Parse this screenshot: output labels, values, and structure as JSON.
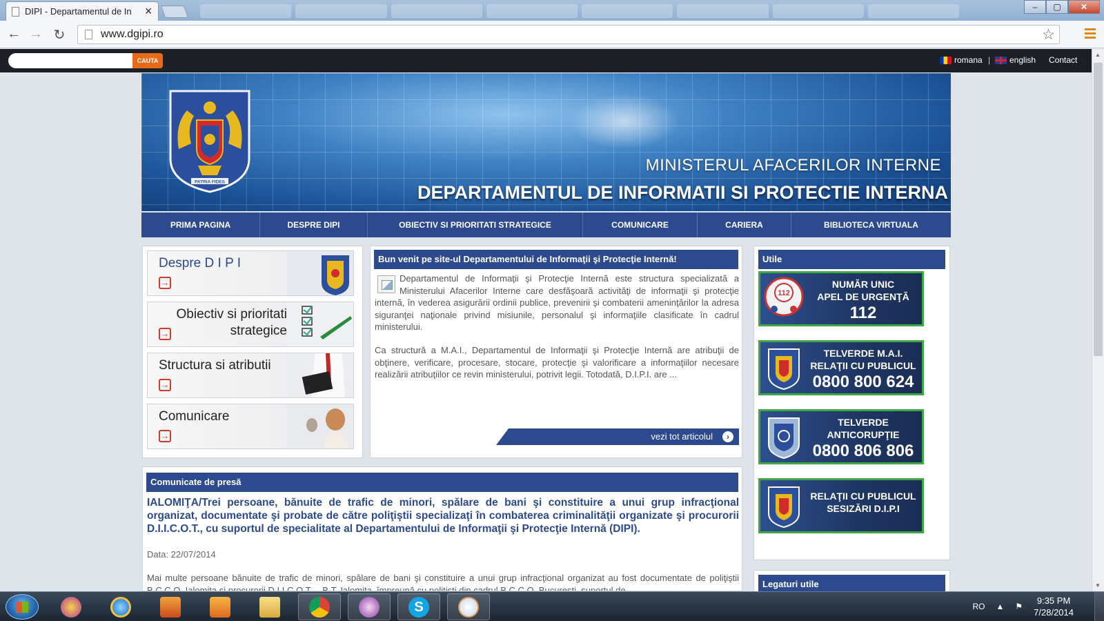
{
  "browser": {
    "tab_title": "DIPI - Departamentul de In",
    "url": "www.dgipi.ro"
  },
  "topbar": {
    "search_placeholder": "",
    "search_button": "CAUTA",
    "lang_ro": "romana",
    "separator": "|",
    "lang_en": "english",
    "contact": "Contact"
  },
  "banner": {
    "line1": "MINISTERUL AFACERILOR INTERNE",
    "line2": "DEPARTAMENTUL DE INFORMATII SI PROTECTIE INTERNA",
    "crest_motto": "PATRIA FIDES"
  },
  "nav": {
    "items": [
      {
        "label": "PRIMA PAGINA"
      },
      {
        "label": "DESPRE DIPI"
      },
      {
        "label": "OBIECTIV SI PRIORITATI STRATEGICE"
      },
      {
        "label": "COMUNICARE"
      },
      {
        "label": "CARIERA"
      },
      {
        "label": "BIBLIOTECA VIRTUALA"
      }
    ]
  },
  "left_tiles": [
    {
      "label": "Despre D I P I"
    },
    {
      "label": "Obiectiv si prioritati strategice"
    },
    {
      "label": "Structura si atributii"
    },
    {
      "label": "Comunicare"
    }
  ],
  "welcome": {
    "heading": "Bun venit pe site-ul Departamentului de Informaţii şi Protecţie Internă!",
    "paragraph1": "Departamentul de Informaţii şi Protecţie Internă este structura specializată a Ministerului Afacerilor Interne care desfăşoară activităţi de informaţii şi protecţie internă, în vederea asigurării ordinii publice, prevenirii şi combaterii ameninţărilor la adresa siguranţei naţionale privind misiunile, personalul şi informaţiile clasificate în cadrul ministerului.",
    "paragraph2": "Ca structură a M.A.I., Departamentul de Informaţii şi Protecţie Internă are atribuţii de obţinere, verificare, procesare, stocare, protecţie şi valorificare a informaţiilor necesare realizării atribuţiilor ce revin ministerului, potrivit legii. Totodată, D.I.P.I. are ...",
    "read_more": "vezi tot articolul"
  },
  "press": {
    "heading": "Comunicate de presă",
    "headline": "IALOMIŢA/Trei persoane, bănuite de trafic de minori, spălare de bani şi constituire a unui grup infracţional organizat, documentate şi probate de către poliţiştii specializaţi în combaterea criminalităţii organizate şi procurorii D.I.I.C.O.T., cu suportul de specialitate al Departamentului de Informaţii şi Protecţie Internă (DIPI).",
    "date": "Data: 22/07/2014",
    "excerpt": "Mai multe persoane bănuite de trafic de minori, spălare de bani şi constituire a unui grup infracţional organizat au fost documentate de poliţiştii B.C.C.O. Ialomiţa şi procurorii D.I.I.C.O.T. – B.T. Ialomiţa, împreună cu poliţişti din cadrul B.C.C.O. Bucureşti, suportul de"
  },
  "utile": {
    "heading": "Utile",
    "items": [
      {
        "title": "NUMĂR UNIC\nAPEL DE URGENŢĂ",
        "number": "112"
      },
      {
        "title": "TELVERDE M.A.I.\nRELAŢII CU PUBLICUL",
        "number": "0800 800 624"
      },
      {
        "title": "TELVERDE\nANTICORUPŢIE",
        "number": "0800 806 806"
      },
      {
        "title": "RELAŢII CU PUBLICUL\nSESIZĂRI D.I.P.I",
        "number": ""
      }
    ]
  },
  "legaturi": {
    "heading": "Legaturi utile"
  },
  "taskbar": {
    "lang": "RO",
    "time": "9:35 PM",
    "date": "7/28/2014"
  },
  "colors": {
    "brand_blue": "#2c4a8d",
    "accent_green": "#3fa844",
    "search_orange": "#e66a18"
  }
}
